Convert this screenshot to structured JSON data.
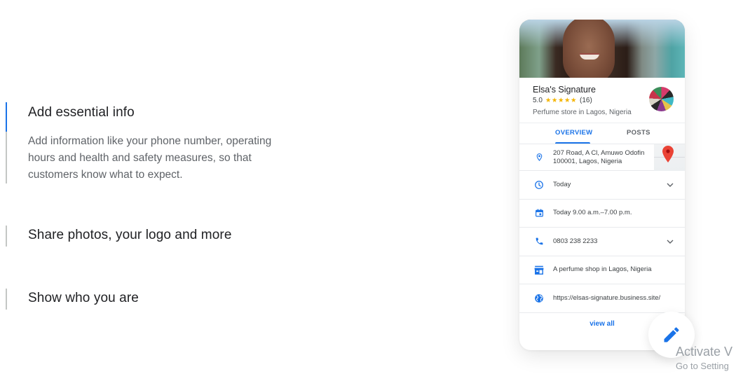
{
  "features": [
    {
      "title": "Add essential info",
      "description": "Add information like your phone number, operating hours and health and safety measures, so that customers know what to expect.",
      "active": true
    },
    {
      "title": "Share photos, your logo and more",
      "active": false
    },
    {
      "title": "Show who you are",
      "active": false
    }
  ],
  "business_card": {
    "hero_image": "woman-smiling-photo",
    "name": "Elsa's Signature",
    "rating": "5.0",
    "stars": "★★★★★",
    "review_count": "(16)",
    "category": "Perfume store in Lagos, Nigeria",
    "logo": "perfume-bottles-logo",
    "tabs": [
      {
        "label": "OVERVIEW",
        "selected": true
      },
      {
        "label": "POSTS",
        "selected": false
      }
    ],
    "info_rows": [
      {
        "icon": "location-pin-icon",
        "text_line1": "207 Road, A Cl, Amuwo Odofin",
        "text_line2": "100001, Lagos, Nigeria",
        "has_map": true
      },
      {
        "icon": "clock-icon",
        "text": "Today",
        "expandable": true
      },
      {
        "icon": "calendar-icon",
        "text": "Today 9.00 a.m.–7.00 p.m."
      },
      {
        "icon": "phone-icon",
        "text": "0803 238 2233",
        "expandable": true
      },
      {
        "icon": "storefront-icon",
        "text": "A perfume shop in Lagos, Nigeria"
      },
      {
        "icon": "globe-icon",
        "text": "https://elsas-signature.business.site/"
      }
    ],
    "view_all_label": "view all"
  },
  "edit_fab": {
    "icon": "pencil-icon"
  },
  "watermark": {
    "line1": "Activate V",
    "line2": "Go to Setting"
  },
  "colors": {
    "accent": "#1a73e8",
    "text_primary": "#202124",
    "text_secondary": "#5f6368",
    "star": "#f4b400",
    "map_pin": "#ea4335"
  }
}
